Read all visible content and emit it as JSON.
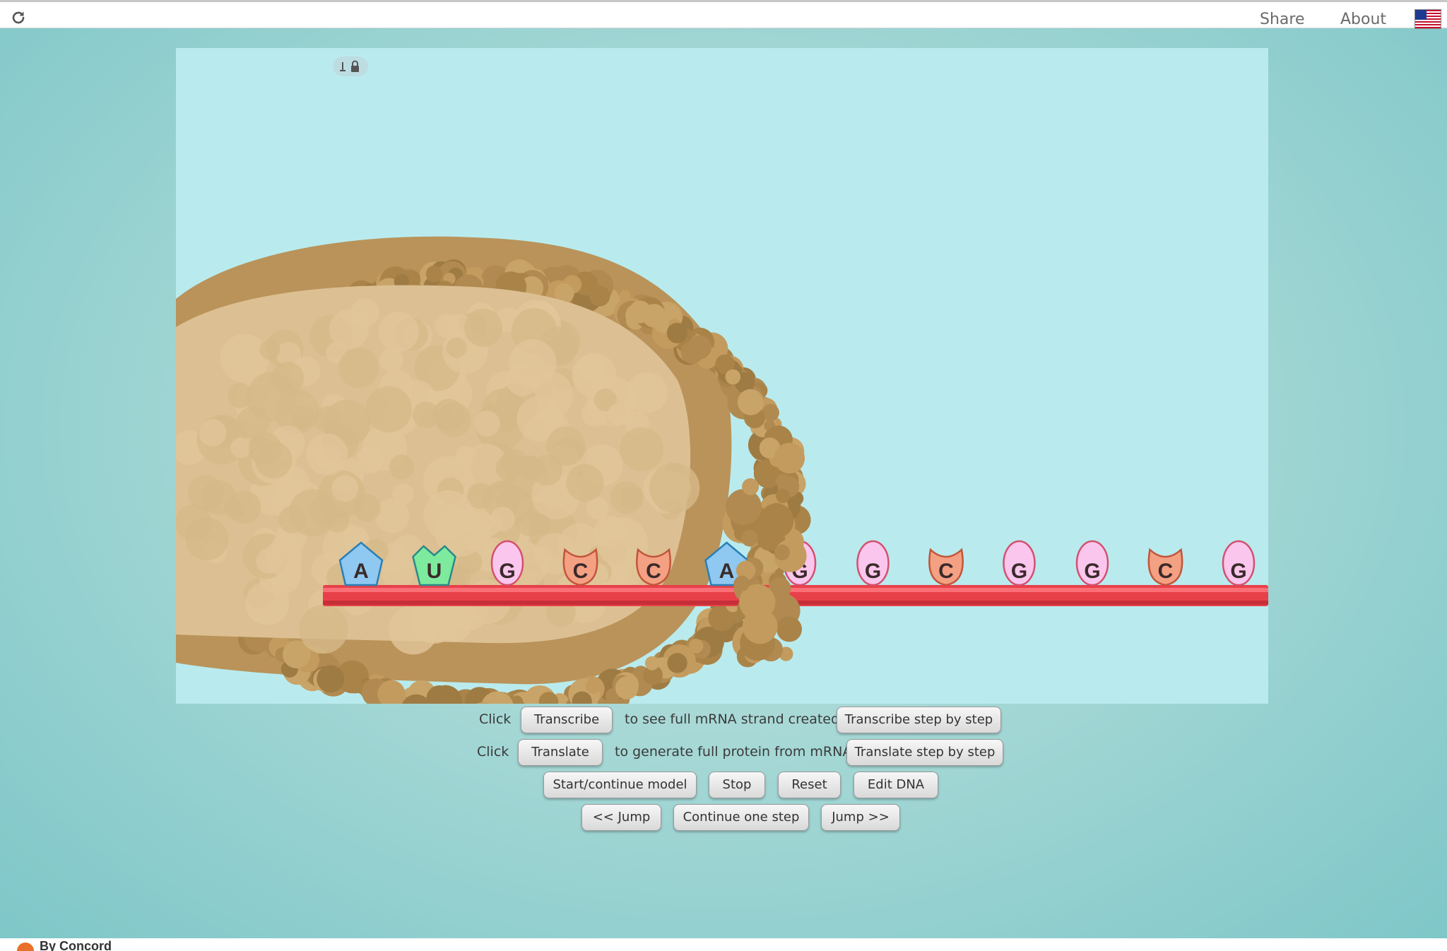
{
  "topbar": {
    "share_label": "Share",
    "about_label": "About",
    "reload_icon": "reload-icon",
    "language_icon": "us-flag-icon"
  },
  "model": {
    "lock_controls": [
      "info-icon",
      "lock-icon"
    ],
    "bases": [
      "A",
      "U",
      "G",
      "C",
      "C",
      "A",
      "G",
      "G",
      "C",
      "G",
      "G",
      "C",
      "G"
    ],
    "colors": {
      "background": "#b9ebee",
      "strand": "#e8404a",
      "A": "#8fc8f0",
      "U": "#7eea9e",
      "G": "#fbc6ee",
      "C": "#f4a083",
      "polymerase": "#d9b98a"
    }
  },
  "controls": {
    "row1": {
      "prefix": "Click",
      "button1": "Transcribe",
      "middle": "to see full mRNA strand created or",
      "button2": "Transcribe step by step"
    },
    "row2": {
      "prefix": "Click",
      "button1": "Translate",
      "middle": "to generate full protein from mRNA or",
      "button2": "Translate step by step"
    },
    "row3": [
      "Start/continue model",
      "Stop",
      "Reset",
      "Edit DNA"
    ],
    "row4": [
      "<< Jump",
      "Continue one step",
      "Jump >>"
    ]
  },
  "footer": {
    "logo_text": "By Concord"
  }
}
